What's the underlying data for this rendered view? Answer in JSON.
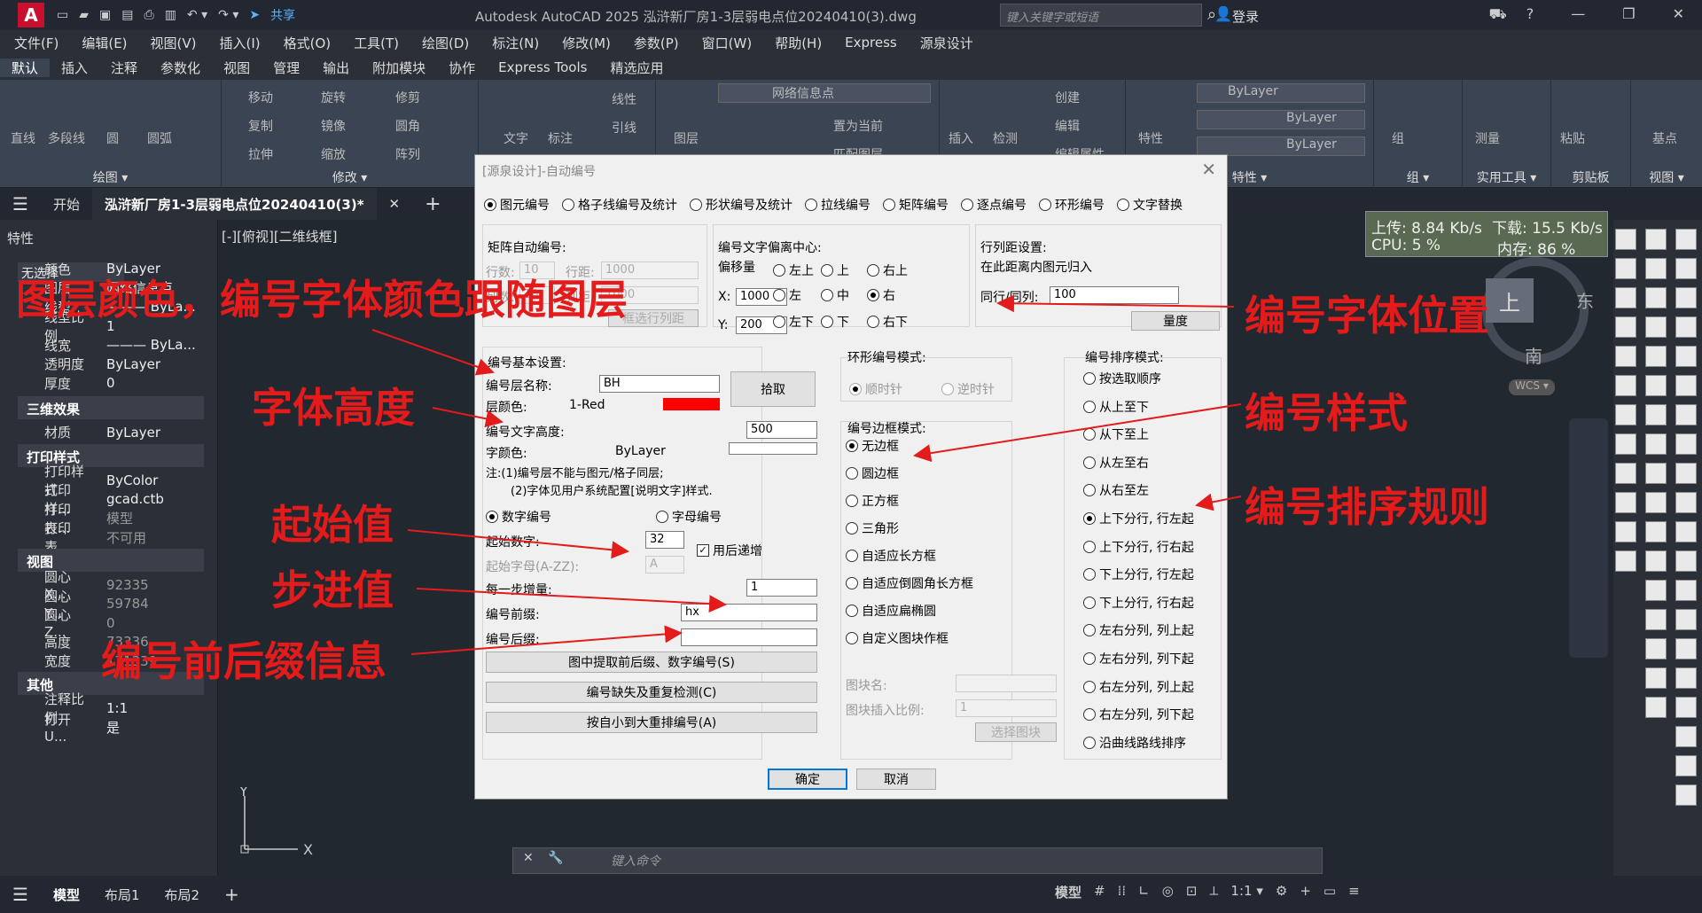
{
  "titlebar": {
    "logo": "A",
    "share": "共享",
    "title": "Autodesk AutoCAD 2025    泓浒新厂房1-3层弱电点位20240410(3).dwg",
    "search_placeholder": "键入关键字或短语",
    "login": "登录"
  },
  "menubar": [
    "文件(F)",
    "编辑(E)",
    "视图(V)",
    "插入(I)",
    "格式(O)",
    "工具(T)",
    "绘图(D)",
    "标注(N)",
    "修改(M)",
    "参数(P)",
    "窗口(W)",
    "帮助(H)",
    "Express",
    "源泉设计"
  ],
  "ribbon_tabs": [
    "默认",
    "插入",
    "注释",
    "参数化",
    "视图",
    "管理",
    "输出",
    "附加模块",
    "协作",
    "Express Tools",
    "精选应用"
  ],
  "ribbon": {
    "draw": {
      "label": "绘图 ▾",
      "items": [
        "直线",
        "多段线",
        "圆",
        "圆弧"
      ]
    },
    "modify": {
      "label": "修改 ▾",
      "items": [
        "移动",
        "旋转",
        "修剪",
        "复制",
        "镜像",
        "圆角",
        "拉伸",
        "缩放",
        "阵列"
      ]
    },
    "annotation": {
      "items": [
        "文字",
        "标注",
        "线性",
        "引线"
      ]
    },
    "layers": {
      "items": [
        "图层",
        "网络信息点",
        "置为当前",
        "匹配图层"
      ]
    },
    "block": {
      "items": [
        "插入",
        "检测",
        "创建",
        "编辑",
        "编辑属性"
      ]
    },
    "properties": {
      "label": "特性 ▾",
      "items": [
        "特性",
        "ByLayer",
        "ByLayer",
        "ByLayer"
      ]
    },
    "group": {
      "label": "组 ▾",
      "items": [
        "组"
      ]
    },
    "utilities": {
      "label": "实用工具 ▾",
      "items": [
        "测量"
      ]
    },
    "clipboard": {
      "label": "剪贴板",
      "items": [
        "粘贴"
      ]
    },
    "view": {
      "label": "视图 ▾",
      "items": [
        "基点"
      ]
    }
  },
  "doctabs": {
    "start": "开始",
    "active": "泓浒新厂房1-3层弱电点位20240410(3)*"
  },
  "viewport": {
    "label": "[-][俯视][二维线框]"
  },
  "properties": {
    "header": "特性",
    "selection": "无选择",
    "rows": [
      {
        "k": "颜色",
        "v": "ByLayer"
      },
      {
        "k": "图层",
        "v": "网络信息点"
      },
      {
        "k": "线型",
        "v": "——— ByLa..."
      },
      {
        "k": "线型比例",
        "v": "1"
      },
      {
        "k": "线宽",
        "v": "——— ByLa..."
      },
      {
        "k": "透明度",
        "v": "ByLayer"
      },
      {
        "k": "厚度",
        "v": "0"
      }
    ],
    "sec_3d": "三维效果",
    "material": {
      "k": "材质",
      "v": "ByLayer"
    },
    "sec_print": "打印样式",
    "print_rows": [
      {
        "k": "打印样式",
        "v": "ByColor"
      },
      {
        "k": "打印样...",
        "v": "gcad.ctb"
      },
      {
        "k": "打印表...",
        "v": "模型"
      },
      {
        "k": "打印表...",
        "v": "不可用"
      }
    ],
    "sec_view": "视图",
    "view_rows": [
      {
        "k": "圆心 X...",
        "v": "92335"
      },
      {
        "k": "圆心 Y...",
        "v": "59784"
      },
      {
        "k": "圆心 Z...",
        "v": "0"
      },
      {
        "k": "高度",
        "v": "73336"
      },
      {
        "k": "宽度",
        "v": "171339"
      }
    ],
    "sec_other": "其他",
    "other_rows": [
      {
        "k": "注释比例",
        "v": "1:1"
      },
      {
        "k": "打开 U...",
        "v": "是"
      }
    ]
  },
  "netmon": {
    "up": "上传: 8.84 Kb/s",
    "down": "下载: 15.5 Kb/s",
    "cpu": "CPU: 5 %",
    "mem": "内存: 86 %"
  },
  "viewcube": {
    "top": "上",
    "east": "东",
    "south": "南",
    "wcs": "WCS ▾"
  },
  "command": {
    "placeholder": "键入命令"
  },
  "statusbar": {
    "tabs": [
      "模型",
      "布局1",
      "布局2"
    ],
    "model": "模型",
    "scale": "1:1 ▾"
  },
  "dialog": {
    "title": "[源泉设计]-自动编号",
    "modes": [
      "图元编号",
      "格子线编号及统计",
      "形状编号及统计",
      "拉线编号",
      "矩阵编号",
      "逐点编号",
      "环形编号",
      "文字替换"
    ],
    "matrix": {
      "title": "矩阵自动编号:",
      "rows_label": "行数:",
      "rows": "10",
      "rowdist_label": "行距:",
      "rowdist": "1000",
      "cols_label": "列数:",
      "cols": "10",
      "coldist_label": "列距:",
      "coldist": "1000",
      "button": "框选行列距"
    },
    "offset": {
      "title": "编号文字偏离中心:",
      "label": "偏移量",
      "x_label": "X:",
      "x": "1000",
      "y_label": "Y:",
      "y": "200",
      "pos": [
        "左上",
        "上",
        "右上",
        "左",
        "中",
        "右",
        "左下",
        "下",
        "右下"
      ]
    },
    "rowcol": {
      "title": "行列距设置:",
      "desc": "在此距离内图元归入",
      "label": "同行/同列:",
      "value": "100",
      "button": "量度"
    },
    "basic": {
      "title": "编号基本设置:",
      "layer_label": "编号层名称:",
      "layer": "BH",
      "pick": "拾取",
      "layer_color_label": "层颜色:",
      "layer_color": "1-Red",
      "height_label": "编号文字高度:",
      "height": "500",
      "font_color_label": "字颜色:",
      "font_color": "ByLayer",
      "note1": "注:(1)编号层不能与图元/格子同层;",
      "note2": "(2)字体见用户系统配置[说明文字]样式.",
      "num_mode": "数字编号",
      "alpha_mode": "字母编号",
      "start_num_label": "起始数字:",
      "start_num": "32",
      "incr_after": "用后递增",
      "start_alpha_label": "起始字母(A-ZZ):",
      "start_alpha": "A",
      "step_label": "每一步增量:",
      "step": "1",
      "prefix_label": "编号前缀:",
      "prefix": "hx",
      "suffix_label": "编号后缀:",
      "suffix": "",
      "btn_extract": "图中提取前后缀、数字编号(S)",
      "btn_check": "编号缺失及重复检测(C)",
      "btn_renumber": "按自小到大重排编号(A)"
    },
    "ring": {
      "title": "环形编号模式:",
      "cw": "顺时针",
      "ccw": "逆时针"
    },
    "frame": {
      "title": "编号边框模式:",
      "options": [
        "无边框",
        "圆边框",
        "正方框",
        "三角形",
        "自适应长方框",
        "自适应倒圆角长方框",
        "自适应扁椭圆",
        "自定义图块作框"
      ],
      "block_name_label": "图块名:",
      "block_scale_label": "图块插入比例:",
      "block_scale": "1",
      "select_block": "选择图块"
    },
    "order": {
      "title": "编号排序模式:",
      "options": [
        "按选取顺序",
        "从上至下",
        "从下至上",
        "从左至右",
        "从右至左",
        "上下分行, 行左起",
        "上下分行, 行右起",
        "下上分行, 行左起",
        "下上分行, 行右起",
        "左右分列, 列上起",
        "左右分列, 列下起",
        "右左分列, 列上起",
        "右左分列, 列下起",
        "沿曲线路线排序"
      ]
    },
    "ok": "确定",
    "cancel": "取消"
  },
  "annotations": {
    "a1": "图层颜色，编号字体颜色跟随图层",
    "a2": "字体高度",
    "a3": "起始值",
    "a4": "步进值",
    "a5": "编号前后缀信息",
    "a6": "编号字体位置",
    "a7": "编号样式",
    "a8": "编号排序规则",
    "color": "#e31b1b"
  }
}
